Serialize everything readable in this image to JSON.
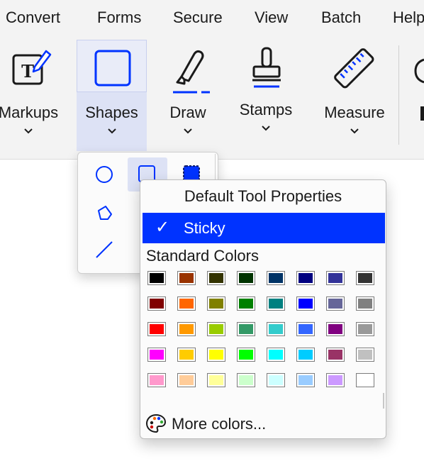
{
  "menubar": {
    "items": [
      {
        "label": "Convert"
      },
      {
        "label": "Forms"
      },
      {
        "label": "Secure"
      },
      {
        "label": "View"
      },
      {
        "label": "Batch"
      },
      {
        "label": "Help"
      }
    ]
  },
  "ribbon": {
    "buttons": [
      {
        "label": "Markups",
        "icon": "markups-text-pen-icon"
      },
      {
        "label": "Shapes",
        "icon": "square-icon",
        "selected": true
      },
      {
        "label": "Draw",
        "icon": "highlighter-icon"
      },
      {
        "label": "Stamps",
        "icon": "stamp-icon"
      },
      {
        "label": "Measure",
        "icon": "ruler-icon"
      }
    ],
    "accent": "#0033ff"
  },
  "shape_panel": {
    "tools": [
      "ellipse-icon",
      "rectangle-icon",
      "filled-rectangle-icon",
      "polygon-icon",
      "line-icon"
    ],
    "selected_tool": "rectangle-icon"
  },
  "popup": {
    "title": "Default Tool Properties",
    "sticky_label": "Sticky",
    "sticky_checked": true,
    "standard_colors_label": "Standard Colors",
    "colors": [
      [
        "#000000",
        "#993300",
        "#333300",
        "#003300",
        "#003366",
        "#000080",
        "#333399",
        "#333333"
      ],
      [
        "#800000",
        "#ff6600",
        "#808000",
        "#008000",
        "#008080",
        "#0000ff",
        "#666699",
        "#808080"
      ],
      [
        "#ff0000",
        "#ff9900",
        "#99cc00",
        "#339966",
        "#33cccc",
        "#3366ff",
        "#800080",
        "#999999"
      ],
      [
        "#ff00ff",
        "#ffcc00",
        "#ffff00",
        "#00ff00",
        "#00ffff",
        "#00ccff",
        "#993366",
        "#c0c0c0"
      ],
      [
        "#ff99cc",
        "#ffcc99",
        "#ffff99",
        "#ccffcc",
        "#ccffff",
        "#99ccff",
        "#cc99ff",
        "#ffffff"
      ]
    ],
    "more_colors_label": "More colors..."
  }
}
